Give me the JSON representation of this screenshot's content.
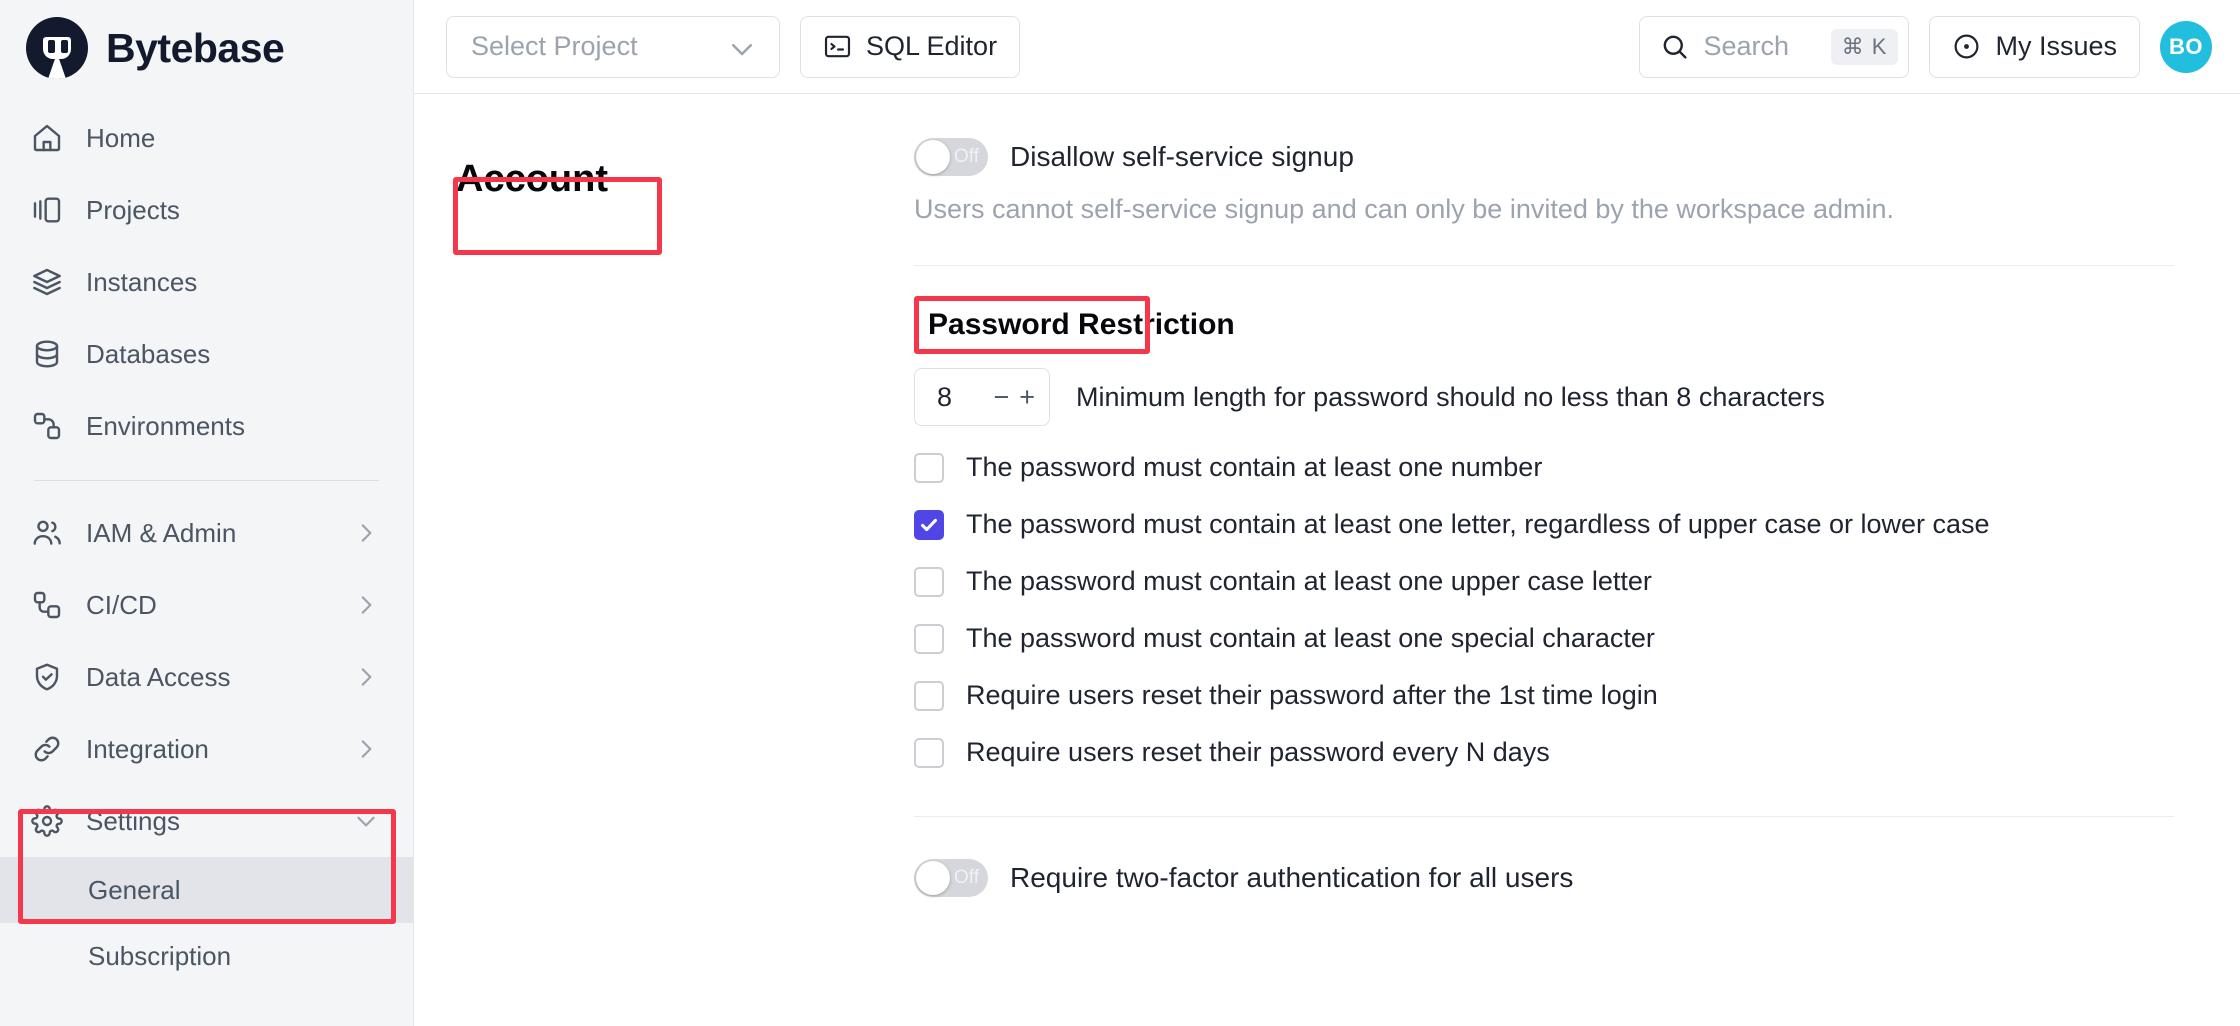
{
  "brand": {
    "name": "Bytebase",
    "logo_icon": "bytebase-logo-icon"
  },
  "sidebar": {
    "items": [
      {
        "label": "Home",
        "icon": "home-icon",
        "expandable": false
      },
      {
        "label": "Projects",
        "icon": "projects-icon",
        "expandable": false
      },
      {
        "label": "Instances",
        "icon": "instances-icon",
        "expandable": false
      },
      {
        "label": "Databases",
        "icon": "databases-icon",
        "expandable": false
      },
      {
        "label": "Environments",
        "icon": "environments-icon",
        "expandable": false
      }
    ],
    "group_items": [
      {
        "label": "IAM & Admin",
        "icon": "users-icon",
        "expandable": true,
        "chevron": "chevron-right-icon"
      },
      {
        "label": "CI/CD",
        "icon": "cicd-icon",
        "expandable": true,
        "chevron": "chevron-right-icon"
      },
      {
        "label": "Data Access",
        "icon": "shield-check-icon",
        "expandable": true,
        "chevron": "chevron-right-icon"
      },
      {
        "label": "Integration",
        "icon": "link-icon",
        "expandable": true,
        "chevron": "chevron-right-icon"
      },
      {
        "label": "Settings",
        "icon": "gear-icon",
        "expandable": true,
        "chevron": "chevron-down-icon"
      }
    ],
    "settings_children": [
      {
        "label": "General",
        "active": true
      },
      {
        "label": "Subscription",
        "active": false
      }
    ]
  },
  "topbar": {
    "project_select": {
      "placeholder": "Select Project",
      "value": "",
      "chevron": "chevron-down-icon"
    },
    "sql_editor": {
      "label": "SQL Editor",
      "icon": "terminal-icon"
    },
    "search": {
      "placeholder": "Search",
      "shortcut": "⌘ K",
      "icon": "search-icon"
    },
    "my_issues": {
      "label": "My Issues",
      "icon": "circle-dot-icon"
    },
    "avatar": {
      "initials": "BO",
      "color": "#22bedd"
    }
  },
  "main": {
    "section_title": "Account",
    "self_service": {
      "toggle_state": "Off",
      "enabled": false,
      "label": "Disallow self-service signup",
      "hint": "Users cannot self-service signup and can only be invited by the workspace admin."
    },
    "password_restriction": {
      "heading": "Password Restriction",
      "min_length": "8",
      "decrement": "−",
      "increment": "+",
      "min_length_text": "Minimum length for password should no less than 8 characters",
      "rules": [
        {
          "label": "The password must contain at least one number",
          "checked": false
        },
        {
          "label": "The password must contain at least one letter, regardless of upper case or lower case",
          "checked": true
        },
        {
          "label": "The password must contain at least one upper case letter",
          "checked": false
        },
        {
          "label": "The password must contain at least one special character",
          "checked": false
        },
        {
          "label": "Require users reset their password after the 1st time login",
          "checked": false
        },
        {
          "label": "Require users reset their password every N days",
          "checked": false
        }
      ]
    },
    "two_factor": {
      "toggle_state": "Off",
      "enabled": false,
      "label": "Require two-factor authentication for all users"
    }
  },
  "annotations": {
    "highlight_color": "#f5374b",
    "boxes": [
      "account-heading",
      "password-restriction-heading",
      "settings-nav-group"
    ]
  }
}
